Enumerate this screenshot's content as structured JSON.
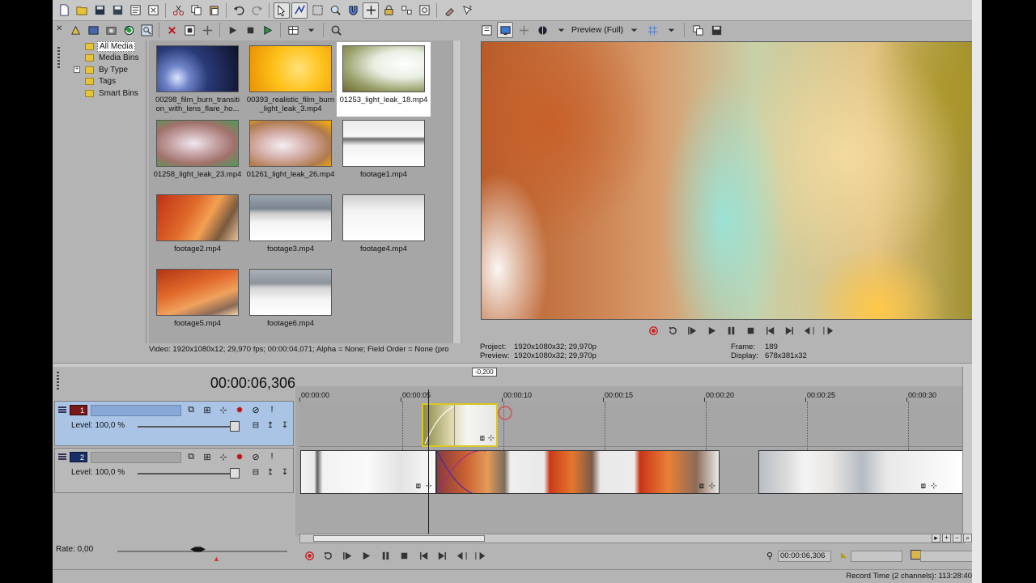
{
  "toolbar": {
    "icons": [
      "new-icon",
      "open-icon",
      "save-icon",
      "save-as-icon",
      "properties-icon",
      "render-icon",
      "cut-icon",
      "copy-icon",
      "paste-icon",
      "undo-icon",
      "redo-icon",
      "normal-edit-icon",
      "envelope-edit-icon",
      "selection-icon",
      "zoom-icon",
      "snapping-icon",
      "auto-ripple-icon",
      "lock-icon",
      "ignore-grouping-icon",
      "help-icon"
    ]
  },
  "explorer": {
    "tree": [
      {
        "label": "All Media",
        "selected": true
      },
      {
        "label": "Media Bins"
      },
      {
        "label": "By Type",
        "expandable": true
      },
      {
        "label": "Tags"
      },
      {
        "label": "Smart Bins"
      }
    ],
    "media": [
      {
        "caption": "00298_film_burn_transiti\non_with_lens_flare_ho...",
        "style": "radial-gradient(circle at 25% 70%, #dde4ff 0%, #6f84c8 18%, #2a3a78 45%, #0d1228 100%)"
      },
      {
        "caption": "00393_realistic_film_burn\n_light_leak_3.mp4",
        "style": "radial-gradient(circle at 60% 50%, #ffe27a 0%, #ffc21c 45%, #e89200 100%)"
      },
      {
        "caption": "01253_light_leak_18.mp4",
        "selected": true,
        "style": "radial-gradient(ellipse at 75% 40%, #ffffff 0%, #e9efe3 35%, #9aa06a 70%, #6b6a30 100%)"
      },
      {
        "caption": "01258_light_leak_23.mp4",
        "style": "radial-gradient(ellipse at 45% 50%, #f0e8f0 0%, #c7a4a6 35%, #a0716a 65%, #4c9c56 100%)"
      },
      {
        "caption": "01261_light_leak_26.mp4",
        "style": "radial-gradient(ellipse at 40% 55%, #f4eef2 0%, #d6b1ad 35%, #b07a4d 70%, #ffb400 100%)"
      },
      {
        "caption": "footage1.mp4",
        "style": "linear-gradient(180deg, #ececec 0%, #f7f7f7 35%, #6d6d6d 40%, #f2f2f2 55%, #ffffff 100%)"
      },
      {
        "caption": "footage2.mp4",
        "style": "linear-gradient(120deg, #c03018 0%, #e06a2a 40%, #f3a052 60%, #7a5a40 80%, #e9c097 100%)"
      },
      {
        "caption": "footage3.mp4",
        "style": "linear-gradient(180deg, #9aa4ad 0%, #7c8590 30%, #c9c9c9 40%, #f4f4f4 60%, #ffffff 100%)"
      },
      {
        "caption": "footage4.mp4",
        "style": "linear-gradient(180deg, #cfcfcf 0%, #f3f3f3 35%, #fafafa 70%, #ffffff 100%)"
      },
      {
        "caption": "footage5.mp4",
        "style": "linear-gradient(160deg, #b23414 0%, #e26a2c 40%, #f0a25e 65%, #8a6a58 85%, #f7d4a8 100%)"
      },
      {
        "caption": "footage6.mp4",
        "style": "linear-gradient(180deg, #aab1b8 0%, #8c939b 30%, #d3d3d3 40%, #f4f4f4 65%, #ffffff 100%)"
      }
    ],
    "status": "Video: 1920x1080x12; 29,970 fps; 00:00:04,071; Alpha = None; Field Order = None (pro"
  },
  "preview": {
    "quality": "Preview (Full)",
    "info": {
      "project_label": "Project:",
      "project_value": "1920x1080x32; 29,970p",
      "preview_label": "Preview:",
      "preview_value": "1920x1080x32; 29,970p",
      "frame_label": "Frame:",
      "frame_value": "189",
      "display_label": "Display:",
      "display_value": "678x381x32"
    }
  },
  "timeline": {
    "time": "00:00:06,306",
    "cursor_offset": "-0,200",
    "ruler": [
      "00:00:00",
      "00:00:05",
      "00:00:10",
      "00:00:15",
      "00:00:20",
      "00:00:25",
      "00:00:30"
    ],
    "tracks": [
      {
        "number": "1",
        "level": "Level: 100,0 %"
      },
      {
        "number": "2",
        "level": "Level: 100,0 %"
      }
    ],
    "rate": "Rate: 0,00",
    "cursor_time": "00:00:06,306"
  },
  "status_bar": {
    "record_time": "Record Time (2 channels): 113:28:40"
  },
  "colors": {
    "track1_header": "#a9c4e4",
    "track1_number": "#7a1818",
    "track2_number": "#1a2f6a",
    "record_red": "#cc1e1e"
  }
}
